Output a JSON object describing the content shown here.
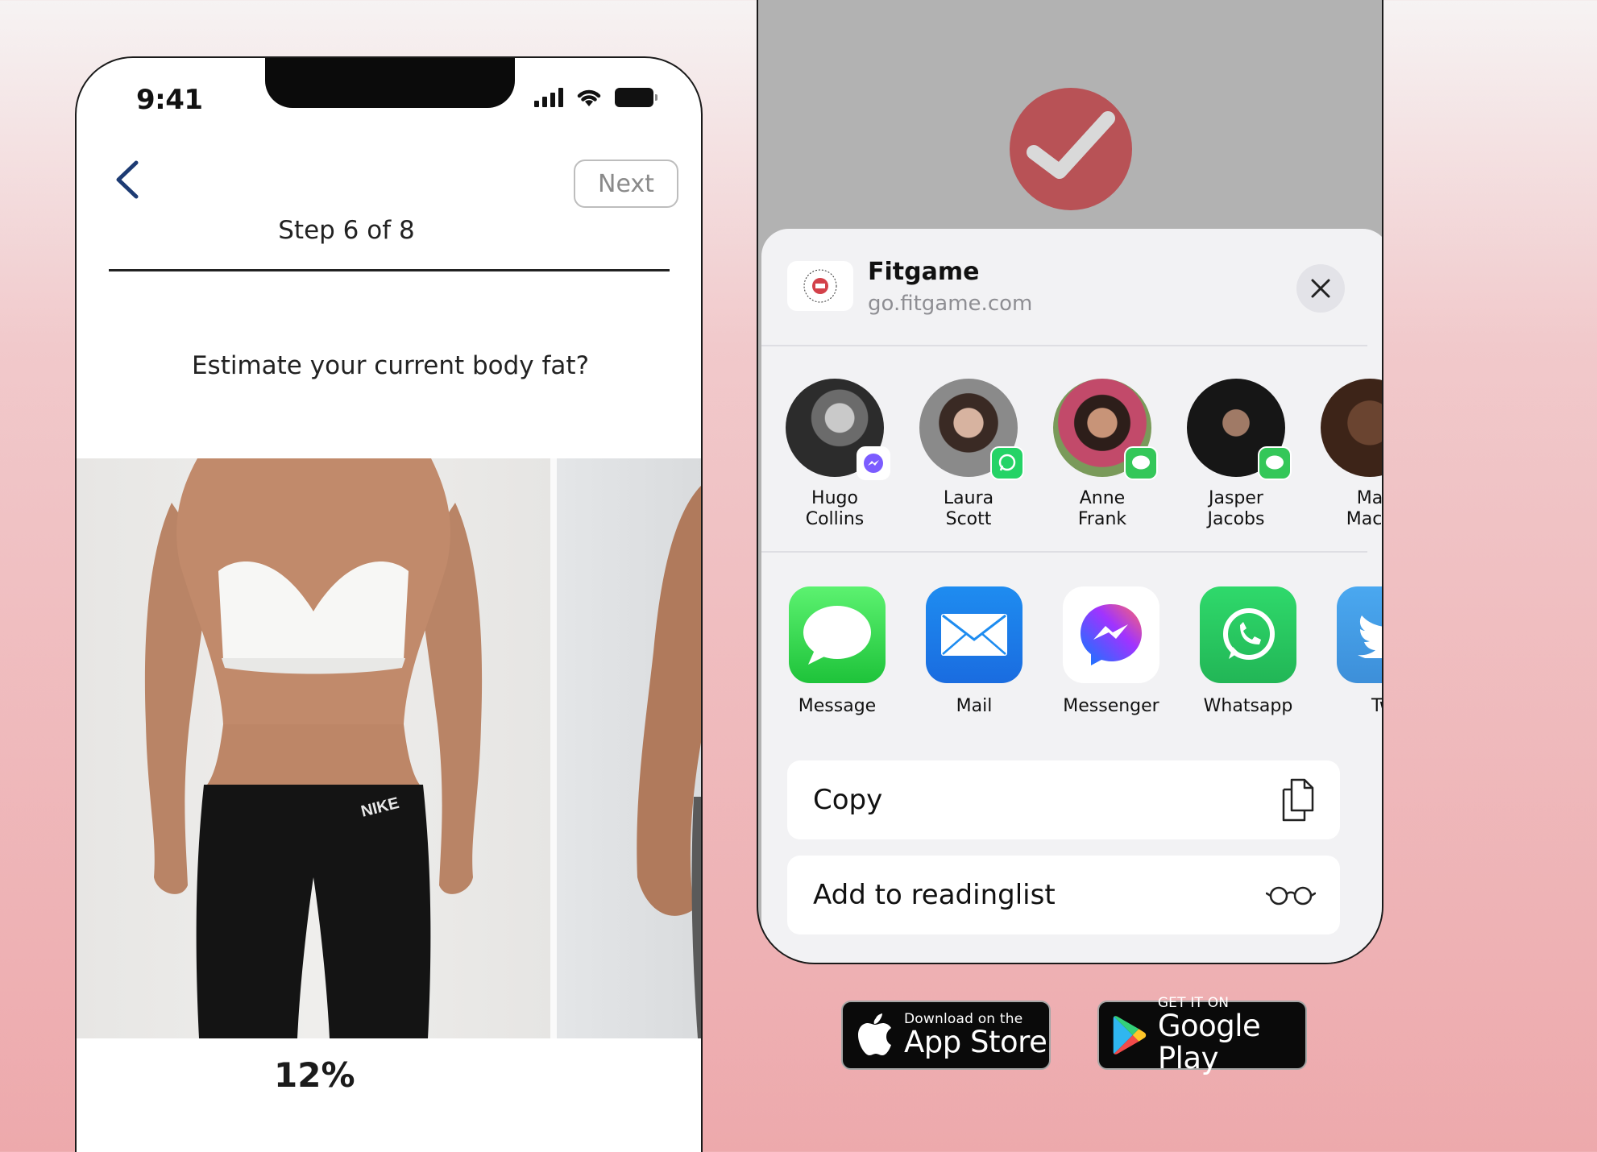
{
  "left_phone": {
    "status_time": "9:41",
    "next_label": "Next",
    "step_label": "Step 6 of 8",
    "question": "Estimate your current body fat?",
    "option_label": "12%",
    "photo_brand_text": "NIKE"
  },
  "right_phone": {
    "app_name": "Fitgame",
    "app_url": "go.fitgame.com",
    "contacts": [
      {
        "name": "Hugo\nCollins",
        "badge": "messenger-badge-icon"
      },
      {
        "name": "Laura\nScott",
        "badge": "whatsapp-badge-icon"
      },
      {
        "name": "Anne\nFrank",
        "badge": "messages-badge-icon"
      },
      {
        "name": "Jasper\nJacobs",
        "badge": "messages-badge-icon"
      },
      {
        "name": "Ma\nMacb",
        "badge": ""
      }
    ],
    "apps": [
      {
        "label": "Message",
        "icon": "messages-app-icon"
      },
      {
        "label": "Mail",
        "icon": "mail-app-icon"
      },
      {
        "label": "Messenger",
        "icon": "messenger-app-icon"
      },
      {
        "label": "Whatsapp",
        "icon": "whatsapp-app-icon"
      },
      {
        "label": "Twi",
        "icon": "twitter-app-icon"
      }
    ],
    "actions": {
      "copy": "Copy",
      "reading_list": "Add to readinglist"
    }
  },
  "store_badges": {
    "app_store": {
      "small": "Download on the",
      "big": "App Store"
    },
    "google_play": {
      "small": "GET IT ON",
      "big": "Google Play"
    }
  },
  "colors": {
    "accent_check": "#b85256",
    "back_chevron": "#1d3b73",
    "whatsapp": "#25d366",
    "messages": "#34c759",
    "mail": "#1e8cf0"
  }
}
